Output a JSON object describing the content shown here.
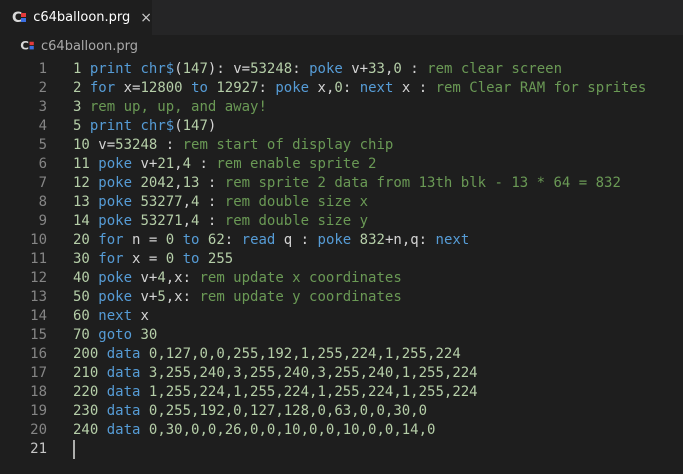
{
  "tab": {
    "title": "c64balloon.prg",
    "close_glyph": "×"
  },
  "breadcrumb": {
    "file": "c64balloon.prg"
  },
  "icon": {
    "letter": "C"
  },
  "colors": {
    "keyword": "#569cd6",
    "comment": "#6a9955",
    "number": "#b5cea8",
    "text": "#d4d4d4"
  },
  "lines": [
    {
      "n": "1",
      "tokens": [
        [
          "nm",
          "1"
        ],
        [
          "tx",
          " "
        ],
        [
          "kw",
          "print"
        ],
        [
          "tx",
          " "
        ],
        [
          "kw",
          "chr$"
        ],
        [
          "tx",
          "("
        ],
        [
          "nm",
          "147"
        ],
        [
          "tx",
          "): v="
        ],
        [
          "nm",
          "53248"
        ],
        [
          "tx",
          ": "
        ],
        [
          "kw",
          "poke"
        ],
        [
          "tx",
          " v+"
        ],
        [
          "nm",
          "33"
        ],
        [
          "tx",
          ","
        ],
        [
          "nm",
          "0"
        ],
        [
          "tx",
          " : "
        ],
        [
          "cm",
          "rem clear screen"
        ]
      ]
    },
    {
      "n": "2",
      "tokens": [
        [
          "nm",
          "2"
        ],
        [
          "tx",
          " "
        ],
        [
          "kw",
          "for"
        ],
        [
          "tx",
          " x="
        ],
        [
          "nm",
          "12800"
        ],
        [
          "tx",
          " "
        ],
        [
          "kw",
          "to"
        ],
        [
          "tx",
          " "
        ],
        [
          "nm",
          "12927"
        ],
        [
          "tx",
          ": "
        ],
        [
          "kw",
          "poke"
        ],
        [
          "tx",
          " x,"
        ],
        [
          "nm",
          "0"
        ],
        [
          "tx",
          ": "
        ],
        [
          "kw",
          "next"
        ],
        [
          "tx",
          " x : "
        ],
        [
          "cm",
          "rem Clear RAM for sprites"
        ]
      ]
    },
    {
      "n": "3",
      "tokens": [
        [
          "nm",
          "3"
        ],
        [
          "tx",
          " "
        ],
        [
          "cm",
          "rem up, up, and away!"
        ]
      ]
    },
    {
      "n": "4",
      "tokens": [
        [
          "nm",
          "5"
        ],
        [
          "tx",
          " "
        ],
        [
          "kw",
          "print"
        ],
        [
          "tx",
          " "
        ],
        [
          "kw",
          "chr$"
        ],
        [
          "tx",
          "("
        ],
        [
          "nm",
          "147"
        ],
        [
          "tx",
          ")"
        ]
      ]
    },
    {
      "n": "5",
      "tokens": [
        [
          "nm",
          "10"
        ],
        [
          "tx",
          " v="
        ],
        [
          "nm",
          "53248"
        ],
        [
          "tx",
          " : "
        ],
        [
          "cm",
          "rem start of display chip"
        ]
      ]
    },
    {
      "n": "6",
      "tokens": [
        [
          "nm",
          "11"
        ],
        [
          "tx",
          " "
        ],
        [
          "kw",
          "poke"
        ],
        [
          "tx",
          " v+"
        ],
        [
          "nm",
          "21"
        ],
        [
          "tx",
          ","
        ],
        [
          "nm",
          "4"
        ],
        [
          "tx",
          " : "
        ],
        [
          "cm",
          "rem enable sprite 2"
        ]
      ]
    },
    {
      "n": "7",
      "tokens": [
        [
          "nm",
          "12"
        ],
        [
          "tx",
          " "
        ],
        [
          "kw",
          "poke"
        ],
        [
          "tx",
          " "
        ],
        [
          "nm",
          "2042"
        ],
        [
          "tx",
          ","
        ],
        [
          "nm",
          "13"
        ],
        [
          "tx",
          " : "
        ],
        [
          "cm",
          "rem sprite 2 data from 13th blk - 13 * 64 = 832"
        ]
      ]
    },
    {
      "n": "8",
      "tokens": [
        [
          "nm",
          "13"
        ],
        [
          "tx",
          " "
        ],
        [
          "kw",
          "poke"
        ],
        [
          "tx",
          " "
        ],
        [
          "nm",
          "53277"
        ],
        [
          "tx",
          ","
        ],
        [
          "nm",
          "4"
        ],
        [
          "tx",
          " : "
        ],
        [
          "cm",
          "rem double size x"
        ]
      ]
    },
    {
      "n": "9",
      "tokens": [
        [
          "nm",
          "14"
        ],
        [
          "tx",
          " "
        ],
        [
          "kw",
          "poke"
        ],
        [
          "tx",
          " "
        ],
        [
          "nm",
          "53271"
        ],
        [
          "tx",
          ","
        ],
        [
          "nm",
          "4"
        ],
        [
          "tx",
          " : "
        ],
        [
          "cm",
          "rem double size y"
        ]
      ]
    },
    {
      "n": "10",
      "tokens": [
        [
          "nm",
          "20"
        ],
        [
          "tx",
          " "
        ],
        [
          "kw",
          "for"
        ],
        [
          "tx",
          " n = "
        ],
        [
          "nm",
          "0"
        ],
        [
          "tx",
          " "
        ],
        [
          "kw",
          "to"
        ],
        [
          "tx",
          " "
        ],
        [
          "nm",
          "62"
        ],
        [
          "tx",
          ": "
        ],
        [
          "kw",
          "read"
        ],
        [
          "tx",
          " q : "
        ],
        [
          "kw",
          "poke"
        ],
        [
          "tx",
          " "
        ],
        [
          "nm",
          "832"
        ],
        [
          "tx",
          "+n,q: "
        ],
        [
          "kw",
          "next"
        ]
      ]
    },
    {
      "n": "11",
      "tokens": [
        [
          "nm",
          "30"
        ],
        [
          "tx",
          " "
        ],
        [
          "kw",
          "for"
        ],
        [
          "tx",
          " x = "
        ],
        [
          "nm",
          "0"
        ],
        [
          "tx",
          " "
        ],
        [
          "kw",
          "to"
        ],
        [
          "tx",
          " "
        ],
        [
          "nm",
          "255"
        ]
      ]
    },
    {
      "n": "12",
      "tokens": [
        [
          "nm",
          "40"
        ],
        [
          "tx",
          " "
        ],
        [
          "kw",
          "poke"
        ],
        [
          "tx",
          " v+"
        ],
        [
          "nm",
          "4"
        ],
        [
          "tx",
          ",x: "
        ],
        [
          "cm",
          "rem update x coordinates"
        ]
      ]
    },
    {
      "n": "13",
      "tokens": [
        [
          "nm",
          "50"
        ],
        [
          "tx",
          " "
        ],
        [
          "kw",
          "poke"
        ],
        [
          "tx",
          " v+"
        ],
        [
          "nm",
          "5"
        ],
        [
          "tx",
          ",x: "
        ],
        [
          "cm",
          "rem update y coordinates"
        ]
      ]
    },
    {
      "n": "14",
      "tokens": [
        [
          "nm",
          "60"
        ],
        [
          "tx",
          " "
        ],
        [
          "kw",
          "next"
        ],
        [
          "tx",
          " x"
        ]
      ]
    },
    {
      "n": "15",
      "tokens": [
        [
          "nm",
          "70"
        ],
        [
          "tx",
          " "
        ],
        [
          "kw",
          "goto"
        ],
        [
          "tx",
          " "
        ],
        [
          "nm",
          "30"
        ]
      ]
    },
    {
      "n": "16",
      "tokens": [
        [
          "nm",
          "200"
        ],
        [
          "tx",
          " "
        ],
        [
          "kw",
          "data"
        ],
        [
          "tx",
          " "
        ],
        [
          "nm",
          "0,127,0,0,255,192,1,255,224,1,255,224"
        ]
      ]
    },
    {
      "n": "17",
      "tokens": [
        [
          "nm",
          "210"
        ],
        [
          "tx",
          " "
        ],
        [
          "kw",
          "data"
        ],
        [
          "tx",
          " "
        ],
        [
          "nm",
          "3,255,240,3,255,240,3,255,240,1,255,224"
        ]
      ]
    },
    {
      "n": "18",
      "tokens": [
        [
          "nm",
          "220"
        ],
        [
          "tx",
          " "
        ],
        [
          "kw",
          "data"
        ],
        [
          "tx",
          " "
        ],
        [
          "nm",
          "1,255,224,1,255,224,1,255,224,1,255,224"
        ]
      ]
    },
    {
      "n": "19",
      "tokens": [
        [
          "nm",
          "230"
        ],
        [
          "tx",
          " "
        ],
        [
          "kw",
          "data"
        ],
        [
          "tx",
          " "
        ],
        [
          "nm",
          "0,255,192,0,127,128,0,63,0,0,30,0"
        ]
      ]
    },
    {
      "n": "20",
      "tokens": [
        [
          "nm",
          "240"
        ],
        [
          "tx",
          " "
        ],
        [
          "kw",
          "data"
        ],
        [
          "tx",
          " "
        ],
        [
          "nm",
          "0,30,0,0,26,0,0,10,0,0,10,0,0,14,0"
        ]
      ]
    },
    {
      "n": "21",
      "tokens": []
    }
  ],
  "current_line": "21"
}
